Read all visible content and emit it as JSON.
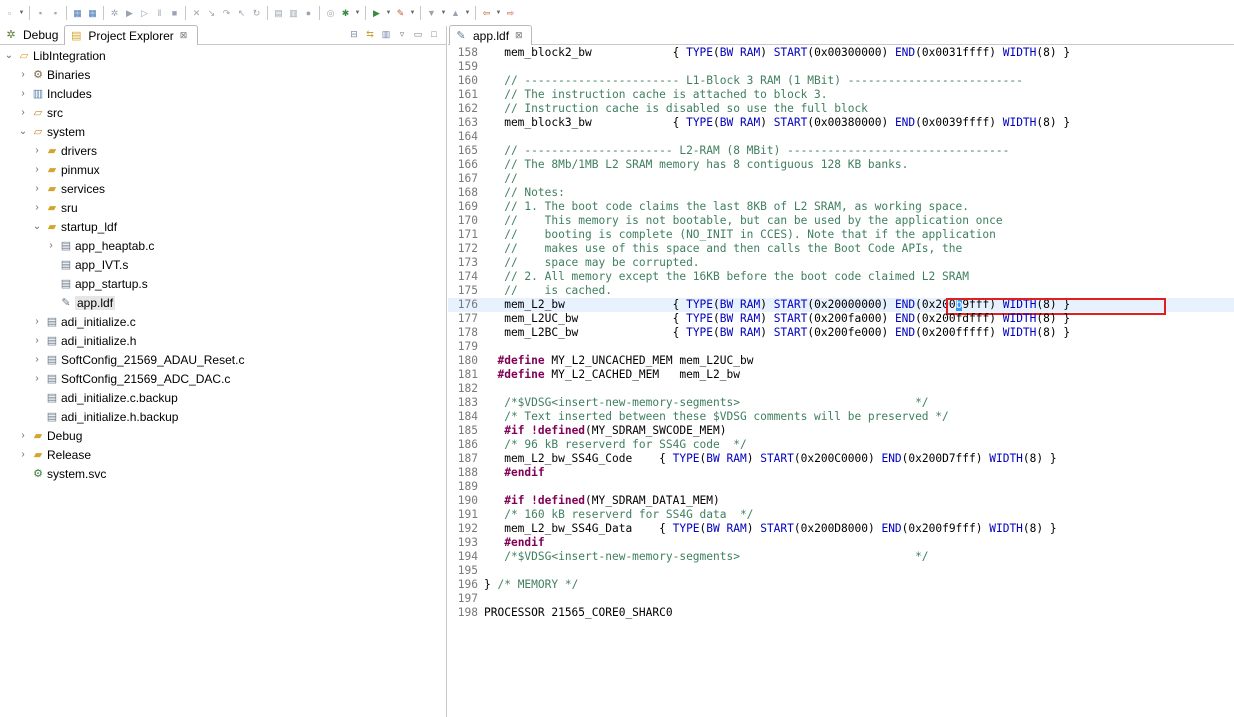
{
  "toolbar": {
    "icons": [
      "new-icon",
      "save-icon",
      "save-all-icon",
      "build-icon",
      "build-all-icon",
      "debug-icon",
      "run-icon",
      "resume-icon",
      "suspend-icon",
      "terminate-icon",
      "disconnect-icon",
      "step-into-icon",
      "step-over-icon",
      "step-return-icon",
      "restart-icon",
      "memory-icon",
      "registers-icon",
      "breakpoint-icon",
      "target-icon",
      "bug-icon",
      "run-config-icon",
      "pen-icon",
      "next-annotation-icon",
      "prev-annotation-icon",
      "back-icon",
      "forward-icon"
    ]
  },
  "left_pane": {
    "tab_debug": "Debug",
    "tab_project_explorer": "Project Explorer",
    "tab_close": "⊠",
    "tree": [
      {
        "label": "LibIntegration",
        "level": 0,
        "twisty": "open",
        "icon": "project-icon"
      },
      {
        "label": "Binaries",
        "level": 1,
        "twisty": "closed",
        "icon": "binaries-icon"
      },
      {
        "label": "Includes",
        "level": 1,
        "twisty": "closed",
        "icon": "includes-icon"
      },
      {
        "label": "src",
        "level": 1,
        "twisty": "closed",
        "icon": "src-folder-icon"
      },
      {
        "label": "system",
        "level": 1,
        "twisty": "open",
        "icon": "src-folder-icon"
      },
      {
        "label": "drivers",
        "level": 2,
        "twisty": "closed",
        "icon": "folder-icon"
      },
      {
        "label": "pinmux",
        "level": 2,
        "twisty": "closed",
        "icon": "folder-icon"
      },
      {
        "label": "services",
        "level": 2,
        "twisty": "closed",
        "icon": "folder-icon"
      },
      {
        "label": "sru",
        "level": 2,
        "twisty": "closed",
        "icon": "folder-icon"
      },
      {
        "label": "startup_ldf",
        "level": 2,
        "twisty": "open",
        "icon": "folder-icon"
      },
      {
        "label": "app_heaptab.c",
        "level": 3,
        "twisty": "closed",
        "icon": "c-file-icon"
      },
      {
        "label": "app_IVT.s",
        "level": 3,
        "twisty": "none",
        "icon": "asm-file-icon"
      },
      {
        "label": "app_startup.s",
        "level": 3,
        "twisty": "none",
        "icon": "asm-file-icon"
      },
      {
        "label": "app.ldf",
        "level": 3,
        "twisty": "none",
        "icon": "ldf-file-icon",
        "selected": true
      },
      {
        "label": "adi_initialize.c",
        "level": 2,
        "twisty": "closed",
        "icon": "c-file-icon"
      },
      {
        "label": "adi_initialize.h",
        "level": 2,
        "twisty": "closed",
        "icon": "h-file-icon"
      },
      {
        "label": "SoftConfig_21569_ADAU_Reset.c",
        "level": 2,
        "twisty": "closed",
        "icon": "c-file-icon"
      },
      {
        "label": "SoftConfig_21569_ADC_DAC.c",
        "level": 2,
        "twisty": "closed",
        "icon": "c-file-icon"
      },
      {
        "label": "adi_initialize.c.backup",
        "level": 2,
        "twisty": "none",
        "icon": "text-file-icon"
      },
      {
        "label": "adi_initialize.h.backup",
        "level": 2,
        "twisty": "none",
        "icon": "text-file-icon"
      },
      {
        "label": "Debug",
        "level": 1,
        "twisty": "closed",
        "icon": "folder-icon"
      },
      {
        "label": "Release",
        "level": 1,
        "twisty": "closed",
        "icon": "folder-icon"
      },
      {
        "label": "system.svc",
        "level": 1,
        "twisty": "none",
        "icon": "svc-file-icon"
      }
    ]
  },
  "editor": {
    "tab_label": "app.ldf",
    "tab_close": "⊠",
    "lines": [
      {
        "n": "158",
        "segs": [
          [
            "t",
            "   mem_block2_bw            { "
          ],
          [
            "p",
            "TYPE"
          ],
          [
            "t",
            "("
          ],
          [
            "p",
            "BW RAM"
          ],
          [
            "t",
            ") "
          ],
          [
            "p",
            "START"
          ],
          [
            "t",
            "(0x00300000) "
          ],
          [
            "p",
            "END"
          ],
          [
            "t",
            "(0x0031ffff) "
          ],
          [
            "p",
            "WIDTH"
          ],
          [
            "t",
            "(8) }"
          ]
        ]
      },
      {
        "n": "159",
        "segs": []
      },
      {
        "n": "160",
        "segs": [
          [
            "c",
            "   // ----------------------- L1-Block 3 RAM (1 MBit) --------------------------"
          ]
        ]
      },
      {
        "n": "161",
        "segs": [
          [
            "c",
            "   // The instruction cache is attached to block 3."
          ]
        ]
      },
      {
        "n": "162",
        "segs": [
          [
            "c",
            "   // Instruction cache is disabled so use the full block"
          ]
        ]
      },
      {
        "n": "163",
        "segs": [
          [
            "t",
            "   mem_block3_bw            { "
          ],
          [
            "p",
            "TYPE"
          ],
          [
            "t",
            "("
          ],
          [
            "p",
            "BW RAM"
          ],
          [
            "t",
            ") "
          ],
          [
            "p",
            "START"
          ],
          [
            "t",
            "(0x00380000) "
          ],
          [
            "p",
            "END"
          ],
          [
            "t",
            "(0x0039ffff) "
          ],
          [
            "p",
            "WIDTH"
          ],
          [
            "t",
            "(8) }"
          ]
        ]
      },
      {
        "n": "164",
        "segs": []
      },
      {
        "n": "165",
        "segs": [
          [
            "c",
            "   // ---------------------- L2-RAM (8 MBit) ---------------------------------"
          ]
        ]
      },
      {
        "n": "166",
        "segs": [
          [
            "c",
            "   // The 8Mb/1MB L2 SRAM memory has 8 contiguous 128 KB banks."
          ]
        ]
      },
      {
        "n": "167",
        "segs": [
          [
            "c",
            "   //"
          ]
        ]
      },
      {
        "n": "168",
        "segs": [
          [
            "c",
            "   // Notes:"
          ]
        ]
      },
      {
        "n": "169",
        "segs": [
          [
            "c",
            "   // 1. The boot code claims the last 8KB of L2 SRAM, as working space."
          ]
        ]
      },
      {
        "n": "170",
        "segs": [
          [
            "c",
            "   //    This memory is not bootable, but can be used by the application once"
          ]
        ]
      },
      {
        "n": "171",
        "segs": [
          [
            "c",
            "   //    booting is complete (NO_INIT in CCES). Note that if the application"
          ]
        ]
      },
      {
        "n": "172",
        "segs": [
          [
            "c",
            "   //    makes use of this space and then calls the Boot Code APIs, the"
          ]
        ]
      },
      {
        "n": "173",
        "segs": [
          [
            "c",
            "   //    space may be corrupted."
          ]
        ]
      },
      {
        "n": "174",
        "segs": [
          [
            "c",
            "   // 2. All memory except the 16KB before the boot code claimed L2 SRAM"
          ]
        ]
      },
      {
        "n": "175",
        "segs": [
          [
            "c",
            "   //    is cached."
          ]
        ]
      },
      {
        "n": "176",
        "current": true,
        "box": true,
        "segs": [
          [
            "t",
            "   mem_L2_bw                { "
          ],
          [
            "p",
            "TYPE"
          ],
          [
            "t",
            "("
          ],
          [
            "p",
            "BW RAM"
          ],
          [
            "t",
            ") "
          ],
          [
            "p",
            "START"
          ],
          [
            "t",
            "(0x20000000) "
          ],
          [
            "p",
            "END"
          ],
          [
            "t",
            "(0x200"
          ],
          [
            "s",
            "b"
          ],
          [
            "t",
            "9fff) "
          ],
          [
            "p",
            "WIDTH"
          ],
          [
            "t",
            "(8) }"
          ]
        ]
      },
      {
        "n": "177",
        "segs": [
          [
            "t",
            "   mem_L2UC_bw              { "
          ],
          [
            "p",
            "TYPE"
          ],
          [
            "t",
            "("
          ],
          [
            "p",
            "BW RAM"
          ],
          [
            "t",
            ") "
          ],
          [
            "p",
            "START"
          ],
          [
            "t",
            "(0x200fa000) "
          ],
          [
            "p",
            "END"
          ],
          [
            "t",
            "(0x200fdfff) "
          ],
          [
            "p",
            "WIDTH"
          ],
          [
            "t",
            "(8) }"
          ]
        ]
      },
      {
        "n": "178",
        "segs": [
          [
            "t",
            "   mem_L2BC_bw              { "
          ],
          [
            "p",
            "TYPE"
          ],
          [
            "t",
            "("
          ],
          [
            "p",
            "BW RAM"
          ],
          [
            "t",
            ") "
          ],
          [
            "p",
            "START"
          ],
          [
            "t",
            "(0x200fe000) "
          ],
          [
            "p",
            "END"
          ],
          [
            "t",
            "(0x200fffff) "
          ],
          [
            "p",
            "WIDTH"
          ],
          [
            "t",
            "(8) }"
          ]
        ]
      },
      {
        "n": "179",
        "segs": []
      },
      {
        "n": "180",
        "segs": [
          [
            "t",
            "  "
          ],
          [
            "k",
            "#define"
          ],
          [
            "t",
            " MY_L2_UNCACHED_MEM mem_L2UC_bw"
          ]
        ]
      },
      {
        "n": "181",
        "segs": [
          [
            "t",
            "  "
          ],
          [
            "k",
            "#define"
          ],
          [
            "t",
            " MY_L2_CACHED_MEM   mem_L2_bw"
          ]
        ]
      },
      {
        "n": "182",
        "segs": []
      },
      {
        "n": "183",
        "segs": [
          [
            "c",
            "   /*$VDSG<insert-new-memory-segments>                          */"
          ]
        ]
      },
      {
        "n": "184",
        "segs": [
          [
            "c",
            "   /* Text inserted between these $VDSG comments will be preserved */"
          ]
        ]
      },
      {
        "n": "185",
        "segs": [
          [
            "t",
            "   "
          ],
          [
            "k",
            "#if !defined"
          ],
          [
            "t",
            "(MY_SDRAM_SWCODE_MEM)"
          ]
        ]
      },
      {
        "n": "186",
        "segs": [
          [
            "c",
            "   /* 96 kB reserverd for SS4G code  */"
          ]
        ]
      },
      {
        "n": "187",
        "segs": [
          [
            "t",
            "   mem_L2_bw_SS4G_Code    { "
          ],
          [
            "p",
            "TYPE"
          ],
          [
            "t",
            "("
          ],
          [
            "p",
            "BW RAM"
          ],
          [
            "t",
            ") "
          ],
          [
            "p",
            "START"
          ],
          [
            "t",
            "(0x200C0000) "
          ],
          [
            "p",
            "END"
          ],
          [
            "t",
            "(0x200D7fff) "
          ],
          [
            "p",
            "WIDTH"
          ],
          [
            "t",
            "(8) }"
          ]
        ]
      },
      {
        "n": "188",
        "segs": [
          [
            "t",
            "   "
          ],
          [
            "k",
            "#endif"
          ]
        ]
      },
      {
        "n": "189",
        "segs": []
      },
      {
        "n": "190",
        "segs": [
          [
            "t",
            "   "
          ],
          [
            "k",
            "#if !defined"
          ],
          [
            "t",
            "(MY_SDRAM_DATA1_MEM)"
          ]
        ]
      },
      {
        "n": "191",
        "segs": [
          [
            "c",
            "   /* 160 kB reserverd for SS4G data  */"
          ]
        ]
      },
      {
        "n": "192",
        "segs": [
          [
            "t",
            "   mem_L2_bw_SS4G_Data    { "
          ],
          [
            "p",
            "TYPE"
          ],
          [
            "t",
            "("
          ],
          [
            "p",
            "BW RAM"
          ],
          [
            "t",
            ") "
          ],
          [
            "p",
            "START"
          ],
          [
            "t",
            "(0x200D8000) "
          ],
          [
            "p",
            "END"
          ],
          [
            "t",
            "(0x200f9fff) "
          ],
          [
            "p",
            "WIDTH"
          ],
          [
            "t",
            "(8) }"
          ]
        ]
      },
      {
        "n": "193",
        "segs": [
          [
            "t",
            "   "
          ],
          [
            "k",
            "#endif"
          ]
        ]
      },
      {
        "n": "194",
        "segs": [
          [
            "c",
            "   /*$VDSG<insert-new-memory-segments>                          */"
          ]
        ]
      },
      {
        "n": "195",
        "segs": []
      },
      {
        "n": "196",
        "segs": [
          [
            "t",
            "} "
          ],
          [
            "c",
            "/* MEMORY */"
          ]
        ]
      },
      {
        "n": "197",
        "segs": []
      },
      {
        "n": "198",
        "segs": [
          [
            "t",
            "PROCESSOR 21565_CORE0_SHARC0"
          ]
        ]
      }
    ]
  }
}
